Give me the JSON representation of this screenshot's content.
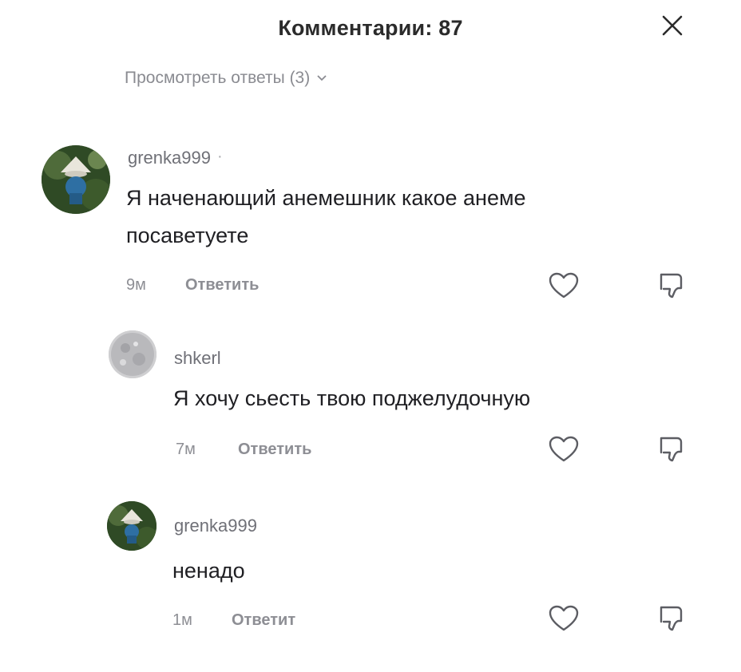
{
  "header": {
    "title": "Комментарии: 87",
    "close_icon": "close-icon"
  },
  "thread": {
    "view_replies_label": "Просмотреть ответы (3)",
    "view_replies_icon": "chevron-down-icon"
  },
  "comments": [
    {
      "username": "grenka999",
      "separator": "·",
      "text_lines": [
        "Я наченающий анемешник какое анеме",
        "посаветуете"
      ],
      "time": "9м",
      "reply_label": "Ответить",
      "like_icon": "heart-icon",
      "dislike_icon": "thumbs-down-icon",
      "avatar_icon": "avatar-image"
    },
    {
      "username": "shkerl",
      "text_lines": [
        "Я хочу сьесть твою поджелудочную"
      ],
      "time": "7м",
      "reply_label": "Ответить",
      "like_icon": "heart-icon",
      "dislike_icon": "thumbs-down-icon",
      "avatar_icon": "avatar-image"
    },
    {
      "username": "grenka999",
      "text_lines": [
        "ненадо"
      ],
      "time": "1м",
      "reply_label": "Ответит",
      "like_icon": "heart-icon",
      "dislike_icon": "thumbs-down-icon",
      "avatar_icon": "avatar-image"
    }
  ],
  "colors": {
    "text_primary": "#1f1f23",
    "text_secondary": "#8d8e94",
    "background": "#ffffff"
  }
}
